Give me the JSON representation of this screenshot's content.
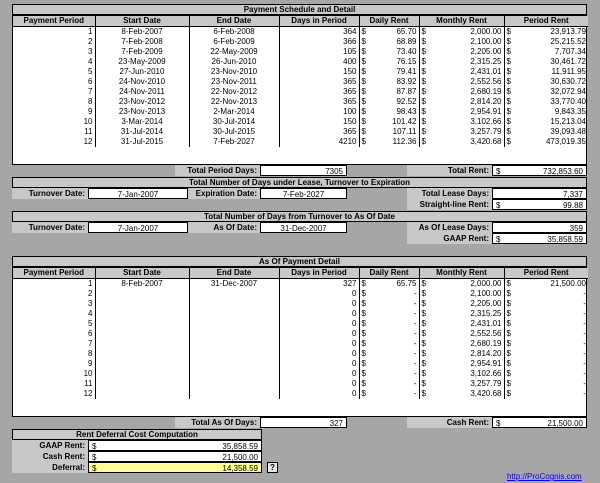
{
  "schedule": {
    "title": "Payment Schedule and Detail",
    "headers": [
      "Payment Period",
      "Start Date",
      "End Date",
      "Days in Period",
      "Daily Rent",
      "Monthly Rent",
      "Period Rent"
    ],
    "currency": "$",
    "rows": [
      [
        "1",
        "8-Feb-2007",
        "6-Feb-2008",
        "364",
        "65.70",
        "2,000.00",
        "23,913.79"
      ],
      [
        "2",
        "7-Feb-2008",
        "6-Feb-2009",
        "366",
        "68.89",
        "2,100.00",
        "25,215.52"
      ],
      [
        "3",
        "7-Feb-2009",
        "22-May-2009",
        "105",
        "73.40",
        "2,205.00",
        "7,707.34"
      ],
      [
        "4",
        "23-May-2009",
        "26-Jun-2010",
        "400",
        "76.15",
        "2,315.25",
        "30,461.72"
      ],
      [
        "5",
        "27-Jun-2010",
        "23-Nov-2010",
        "150",
        "79.41",
        "2,431.01",
        "11,911.95"
      ],
      [
        "6",
        "24-Nov-2010",
        "23-Nov-2011",
        "365",
        "83.92",
        "2,552.56",
        "30,630.72"
      ],
      [
        "7",
        "24-Nov-2011",
        "22-Nov-2012",
        "365",
        "87.87",
        "2,680.19",
        "32,072.94"
      ],
      [
        "8",
        "23-Nov-2012",
        "22-Nov-2013",
        "365",
        "92.52",
        "2,814.20",
        "33,770.40"
      ],
      [
        "9",
        "23-Nov-2013",
        "2-Mar-2014",
        "100",
        "98.43",
        "2,954.91",
        "9,843.35"
      ],
      [
        "10",
        "3-Mar-2014",
        "30-Jul-2014",
        "150",
        "101.42",
        "3,102.66",
        "15,213.04"
      ],
      [
        "11",
        "31-Jul-2014",
        "30-Jul-2015",
        "365",
        "107.11",
        "3,257.79",
        "39,093.48"
      ],
      [
        "12",
        "31-Jul-2015",
        "7-Feb-2027",
        "4210",
        "112.36",
        "3,420.68",
        "473,019.35"
      ]
    ],
    "total_period_days_label": "Total Period Days:",
    "total_period_days": "7305",
    "total_rent_label": "Total Rent:",
    "total_rent": "732,853.60"
  },
  "lease": {
    "title": "Total Number of Days under Lease, Turnover to Expiration",
    "turnover_label": "Turnover Date:",
    "turnover_value": "7-Jan-2007",
    "expiration_label": "Expiration Date:",
    "expiration_value": "7-Feb-2027",
    "total_lease_days_label": "Total Lease Days:",
    "total_lease_days": "7,337",
    "straight_line_label": "Straight-line Rent:",
    "straight_line_value": "99.88"
  },
  "asof": {
    "title": "Total Number of Days from Turnover to As Of Date",
    "turnover_label": "Turnover Date:",
    "turnover_value": "7-Jan-2007",
    "asof_label": "As Of Date:",
    "asof_value": "31-Dec-2007",
    "asof_days_label": "As Of Lease Days:",
    "asof_days": "359",
    "gaap_rent_label": "GAAP Rent:",
    "gaap_rent": "35,858.59"
  },
  "detail": {
    "title": "As Of Payment Detail",
    "headers": [
      "Payment Period",
      "Start Date",
      "End Date",
      "Days in Period",
      "Daily Rent",
      "Monthly Rent",
      "Period Rent"
    ],
    "rows": [
      [
        "1",
        "8-Feb-2007",
        "31-Dec-2007",
        "327",
        "65.75",
        "2,000.00",
        "21,500.00"
      ],
      [
        "2",
        "",
        "",
        "0",
        "-",
        "2,100.00",
        "-"
      ],
      [
        "3",
        "",
        "",
        "0",
        "-",
        "2,205.00",
        "-"
      ],
      [
        "4",
        "",
        "",
        "0",
        "-",
        "2,315.25",
        "-"
      ],
      [
        "5",
        "",
        "",
        "0",
        "-",
        "2,431.01",
        "-"
      ],
      [
        "6",
        "",
        "",
        "0",
        "-",
        "2,552.56",
        "-"
      ],
      [
        "7",
        "",
        "",
        "0",
        "-",
        "2,680.19",
        "-"
      ],
      [
        "8",
        "",
        "",
        "0",
        "-",
        "2,814.20",
        "-"
      ],
      [
        "9",
        "",
        "",
        "0",
        "-",
        "2,954.91",
        "-"
      ],
      [
        "10",
        "",
        "",
        "0",
        "-",
        "3,102.66",
        "-"
      ],
      [
        "11",
        "",
        "",
        "0",
        "-",
        "3,257.79",
        "-"
      ],
      [
        "12",
        "",
        "",
        "0",
        "-",
        "3,420.68",
        "-"
      ]
    ],
    "total_asof_days_label": "Total As Of Days:",
    "total_asof_days": "327",
    "cash_rent_label": "Cash Rent:",
    "cash_rent": "21,500.00"
  },
  "deferral": {
    "title": "Rent Deferral Cost Computation",
    "gaap_label": "GAAP Rent:",
    "gaap_value": "35,858.59",
    "cash_label": "Cash Rent:",
    "cash_value": "21,500.00",
    "deferral_label": "Deferral:",
    "deferral_value": "14,358.59",
    "help_label": "?"
  },
  "footer_link": "http://ProCognis.com"
}
